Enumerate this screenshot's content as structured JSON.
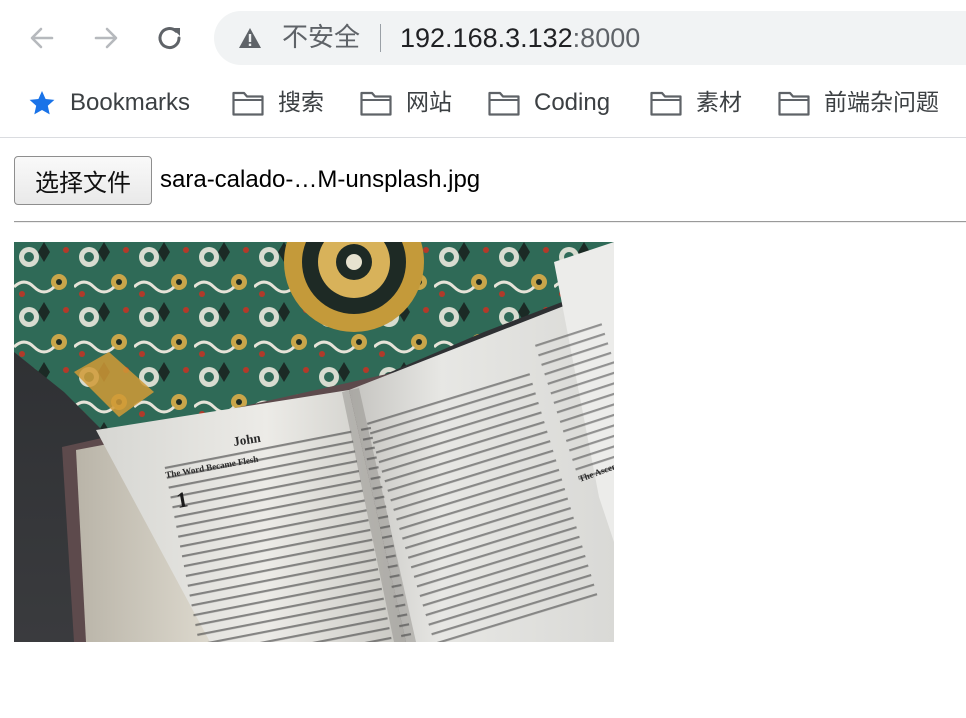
{
  "browser": {
    "security_label": "不安全",
    "url_host": "192.168.3.132",
    "url_port": ":8000"
  },
  "bookmarks": {
    "star_label": "Bookmarks",
    "folders": [
      "搜索",
      "网站",
      "Coding",
      "素材",
      "前端杂问题"
    ]
  },
  "page": {
    "file_button_label": "选择文件",
    "file_name": "sara-calado-…M-unsplash.jpg"
  },
  "image": {
    "description": "open bible book on patterned fabric",
    "left_page_heading": "John",
    "left_page_subheading": "The Word Became Flesh",
    "right_page_side_note": "The Ascen"
  },
  "colors": {
    "accent_blue": "#1a73e8",
    "toolbar_bg": "#ffffff",
    "omnibox_bg": "#f1f3f4"
  }
}
